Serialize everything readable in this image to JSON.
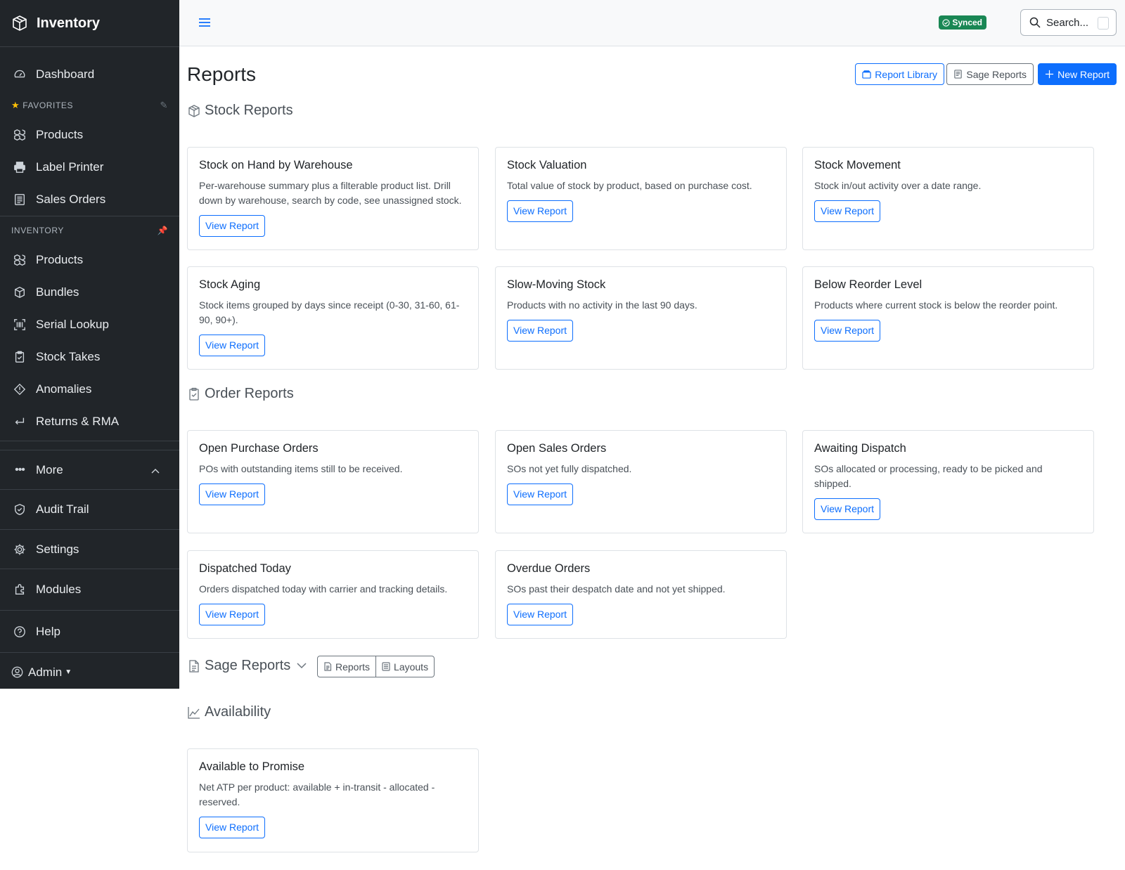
{
  "app": {
    "title": "Inventory"
  },
  "sidebar": {
    "dashboard": {
      "label": "Dashboard",
      "icon": "speedometer-icon"
    },
    "favorites_label": "FAVORITES",
    "favorites": [
      {
        "label": "Products",
        "icon": "boxes-icon"
      },
      {
        "label": "Label Printer",
        "icon": "printer-icon"
      },
      {
        "label": "Sales Orders",
        "icon": "receipt-icon"
      }
    ],
    "inventory_label": "INVENTORY",
    "inventory": [
      {
        "label": "Products",
        "icon": "boxes-icon"
      },
      {
        "label": "Bundles",
        "icon": "box-icon"
      },
      {
        "label": "Serial Lookup",
        "icon": "barcode-icon"
      },
      {
        "label": "Stock Takes",
        "icon": "clipboard-check-icon"
      },
      {
        "label": "Anomalies",
        "icon": "diamond-exclamation-icon"
      },
      {
        "label": "Returns & RMA",
        "icon": "return-arrow-icon"
      }
    ],
    "more": {
      "label": "More"
    },
    "audit": {
      "label": "Audit Trail"
    },
    "settings": {
      "label": "Settings"
    },
    "modules": {
      "label": "Modules"
    },
    "help": {
      "label": "Help"
    },
    "user": {
      "label": "Admin"
    }
  },
  "topbar": {
    "status": "Synced",
    "search_placeholder": "Search..."
  },
  "page": {
    "title": "Reports",
    "buttons": {
      "library": "Report Library",
      "sage": "Sage Reports",
      "new": "New Report"
    }
  },
  "sections": {
    "stock": {
      "title": "Stock Reports",
      "cards": [
        {
          "title": "Stock on Hand by Warehouse",
          "desc": "Per-warehouse summary plus a filterable product list. Drill down by warehouse, search by code, see unassigned stock.",
          "button": "View Report"
        },
        {
          "title": "Stock Valuation",
          "desc": "Total value of stock by product, based on purchase cost.",
          "button": "View Report"
        },
        {
          "title": "Stock Movement",
          "desc": "Stock in/out activity over a date range.",
          "button": "View Report"
        },
        {
          "title": "Stock Aging",
          "desc": "Stock items grouped by days since receipt (0-30, 31-60, 61-90, 90+).",
          "button": "View Report"
        },
        {
          "title": "Slow-Moving Stock",
          "desc": "Products with no activity in the last 90 days.",
          "button": "View Report"
        },
        {
          "title": "Below Reorder Level",
          "desc": "Products where current stock is below the reorder point.",
          "button": "View Report"
        }
      ]
    },
    "order": {
      "title": "Order Reports",
      "cards": [
        {
          "title": "Open Purchase Orders",
          "desc": "POs with outstanding items still to be received.",
          "button": "View Report"
        },
        {
          "title": "Open Sales Orders",
          "desc": "SOs not yet fully dispatched.",
          "button": "View Report"
        },
        {
          "title": "Awaiting Dispatch",
          "desc": "SOs allocated or processing, ready to be picked and shipped.",
          "button": "View Report"
        },
        {
          "title": "Dispatched Today",
          "desc": "Orders dispatched today with carrier and tracking details.",
          "button": "View Report"
        },
        {
          "title": "Overdue Orders",
          "desc": "SOs past their despatch date and not yet shipped.",
          "button": "View Report"
        }
      ]
    },
    "sage": {
      "title": "Sage Reports",
      "toggle": [
        "Reports",
        "Layouts"
      ]
    },
    "availability": {
      "title": "Availability",
      "cards": [
        {
          "title": "Available to Promise",
          "desc": "Net ATP per product: available + in-transit - allocated - reserved.",
          "button": "View Report"
        }
      ]
    }
  },
  "colors": {
    "sidebar_bg": "#212529",
    "primary": "#0d6efd",
    "success": "#198754",
    "pin": "#4a90e2"
  }
}
